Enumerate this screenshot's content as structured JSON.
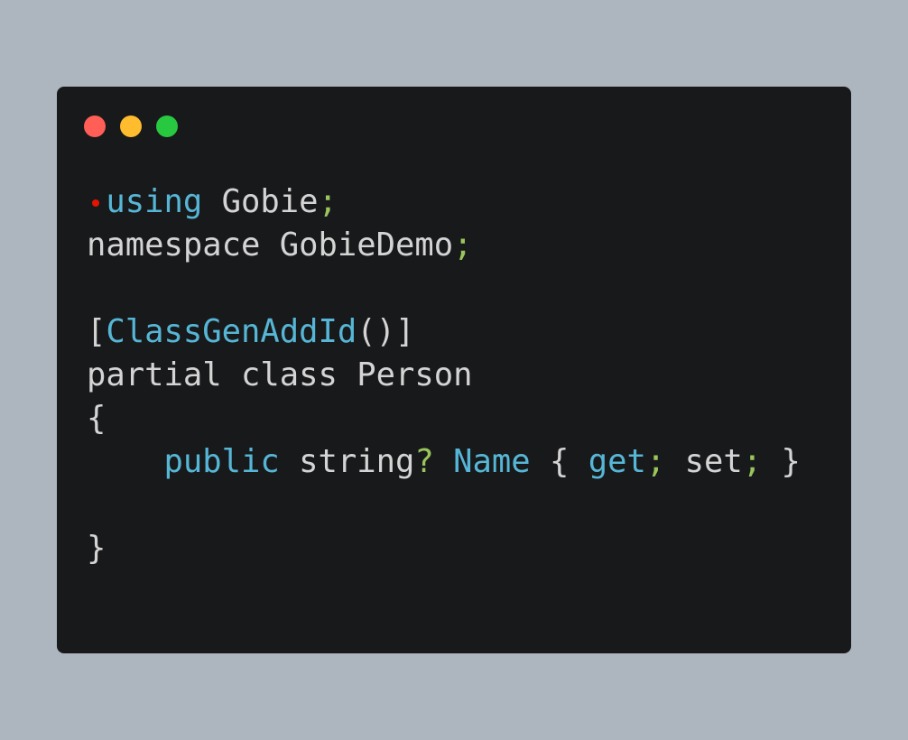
{
  "window": {
    "controls": [
      {
        "name": "close",
        "color": "#ff5f57"
      },
      {
        "name": "minimize",
        "color": "#febc2e"
      },
      {
        "name": "maximize",
        "color": "#28c840"
      }
    ]
  },
  "colors": {
    "background": "#adb6bf",
    "editor": "#18191b",
    "keyword": "#56b6d6",
    "text": "#d4d4d4",
    "punctuation": "#9ac55c",
    "marker": "#e51400"
  },
  "code": {
    "line1": {
      "kw": "using",
      "sp": " ",
      "name": "Gobie",
      "semi": ";"
    },
    "line2": {
      "text": "namespace GobieDemo",
      "semi": ";"
    },
    "line4": {
      "open": "[",
      "attr": "ClassGenAddId",
      "parens": "()",
      "close": "]"
    },
    "line5": {
      "text": "partial class Person"
    },
    "line6": {
      "text": "{"
    },
    "line7": {
      "indent": "    ",
      "kw_public": "public",
      "sp1": " ",
      "type": "string",
      "question": "?",
      "sp2": " ",
      "prop": "Name",
      "brace_open": " { ",
      "get": "get",
      "semi1": ";",
      "set": " set",
      "semi2": ";",
      "brace_close": " }"
    },
    "line9": {
      "text": "}"
    }
  }
}
